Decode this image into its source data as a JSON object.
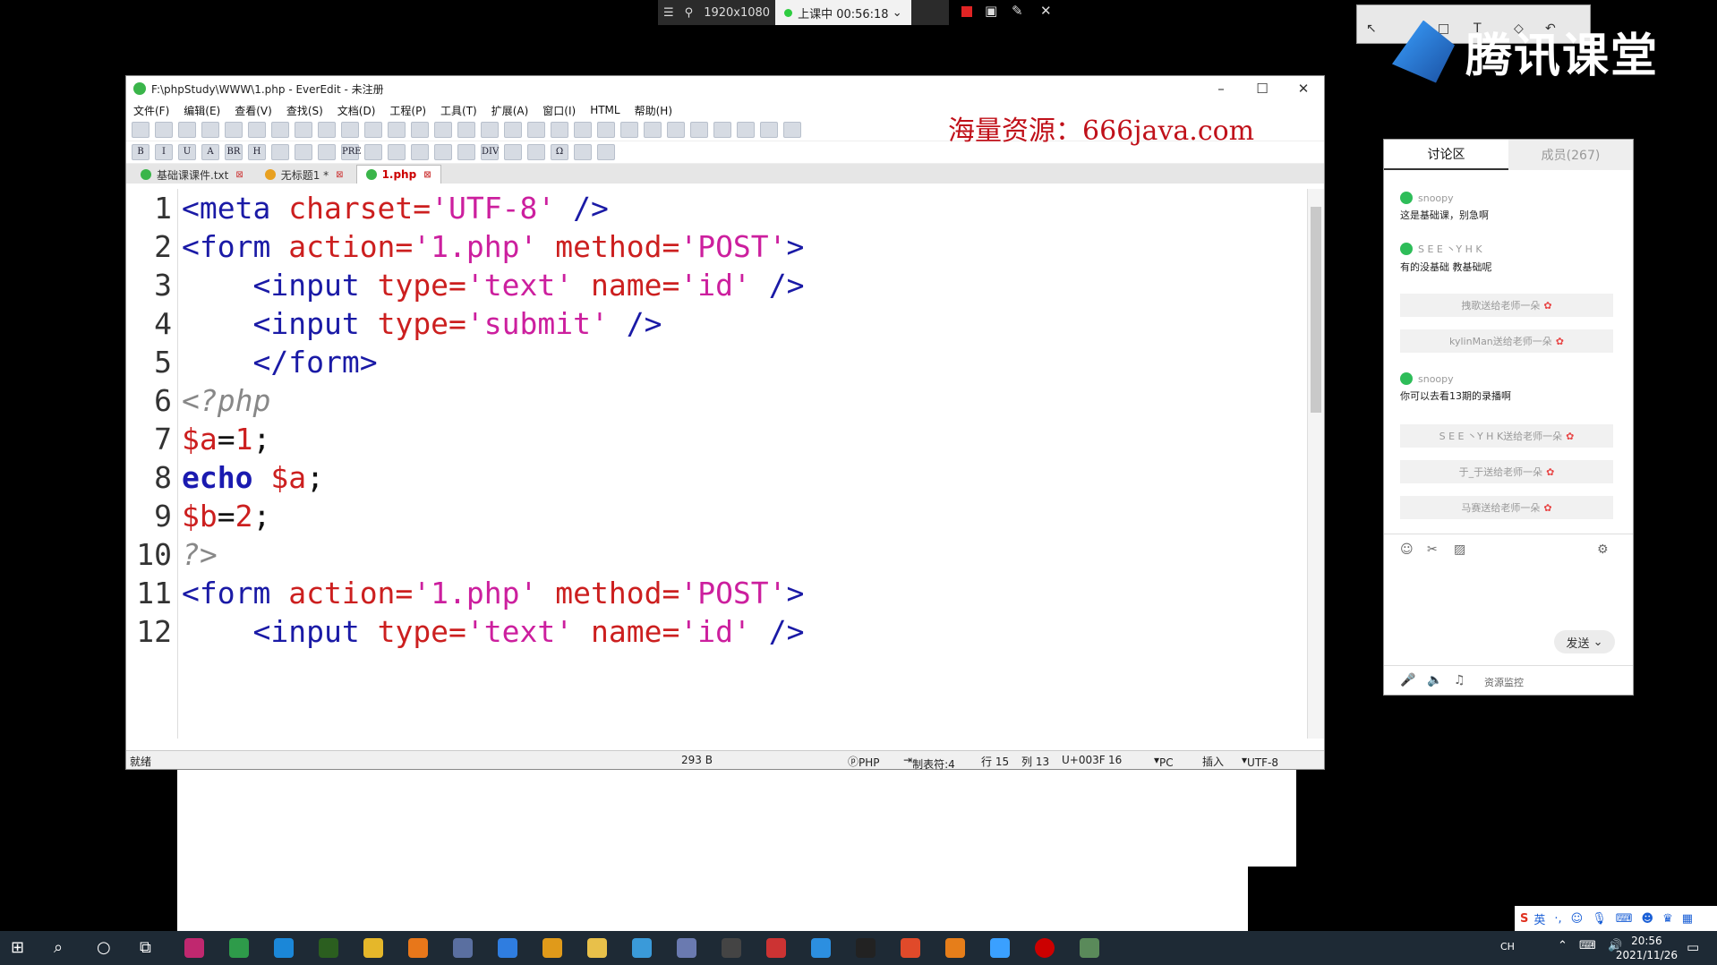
{
  "recording": {
    "resolution": "1920x1080",
    "status": "上课中 00:56:18"
  },
  "branding": {
    "name": "腾讯课堂"
  },
  "editor": {
    "title": "F:\\phpStudy\\WWW\\1.php - EverEdit - 未注册",
    "menus": [
      "文件(F)",
      "编辑(E)",
      "查看(V)",
      "查找(S)",
      "文档(D)",
      "工程(P)",
      "工具(T)",
      "扩展(A)",
      "窗口(I)",
      "HTML",
      "帮助(H)"
    ],
    "watermark": "海量资源：666java.com",
    "format_toolbar": [
      "B",
      "I",
      "U",
      "A",
      "BR",
      "H",
      "PRE",
      "DIV",
      "Ω"
    ],
    "tabs": [
      {
        "label": "基础课课件.txt",
        "active": false
      },
      {
        "label": "无标题1 *",
        "active": false
      },
      {
        "label": "1.php",
        "active": true
      }
    ],
    "lines": [
      {
        "n": "1"
      },
      {
        "n": "2"
      },
      {
        "n": "3"
      },
      {
        "n": "4"
      },
      {
        "n": "5"
      },
      {
        "n": "6"
      },
      {
        "n": "7"
      },
      {
        "n": "8"
      },
      {
        "n": "9"
      },
      {
        "n": "10"
      },
      {
        "n": "11"
      },
      {
        "n": "12"
      }
    ],
    "code": {
      "l1": {
        "a": "<meta",
        "b": "charset=",
        "c": "'UTF-8'",
        "d": "/>"
      },
      "l2": {
        "a": "<form",
        "b": "action=",
        "c": "'1.php'",
        "d": "method=",
        "e": "'POST'",
        "f": ">"
      },
      "l3": {
        "a": "<input",
        "b": "type=",
        "c": "'text'",
        "d": "name=",
        "e": "'id'",
        "f": "/>"
      },
      "l4": {
        "a": "<input",
        "b": "type=",
        "c": "'submit'",
        "d": "/>"
      },
      "l5": {
        "a": "</form>"
      },
      "l6": {
        "a": "<?php"
      },
      "l7": {
        "a": "$a",
        "b": "=",
        "c": "1",
        "d": ";"
      },
      "l8": {
        "a": "echo",
        "b": "$a",
        "c": ";"
      },
      "l9": {
        "a": "$b",
        "b": "=",
        "c": "2",
        "d": ";"
      },
      "l10": {
        "a": "?>"
      },
      "l11": {
        "a": "<form",
        "b": "action=",
        "c": "'1.php'",
        "d": "method=",
        "e": "'POST'",
        "f": ">"
      },
      "l12": {
        "a": "<input",
        "b": "type=",
        "c": "'text'",
        "d": "name=",
        "e": "'id'",
        "f": "/>"
      }
    },
    "status": {
      "state": "就绪",
      "size": "293 B",
      "syntax": "PHP",
      "tab": "制表符:4",
      "row": "行 15",
      "col": "列 13",
      "unicode": "U+003F",
      "code_num": "16",
      "lineend": "PC",
      "mode": "插入",
      "encoding": "UTF-8"
    }
  },
  "chat": {
    "tab_discuss": "讨论区",
    "tab_members": "成员(267)",
    "messages": [
      {
        "user": "snoopy",
        "text": "这是基础课，别急啊"
      },
      {
        "user": "S E E 丶Y H K",
        "text": "有的没基础  教基础呢"
      },
      {
        "user": "snoopy",
        "text": "你可以去看13期的录播啊"
      }
    ],
    "gifts": [
      "拽歌送给老师一朵",
      "kylinMan送给老师一朵",
      "S E E 丶Y H K送给老师一朵",
      "于_于送给老师一朵",
      "马赛送给老师一朵"
    ],
    "send": "发送",
    "monitor": "资源监控"
  },
  "taskbar": {
    "time": "20:56",
    "date": "2021/11/26",
    "lang": "英",
    "tray_lang": "CH"
  }
}
